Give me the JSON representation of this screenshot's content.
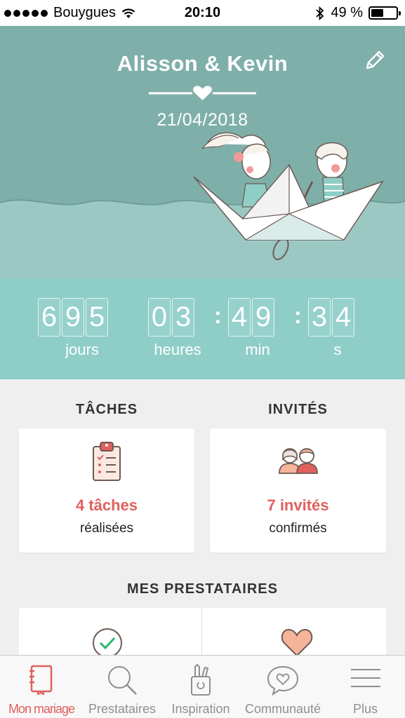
{
  "status_bar": {
    "carrier": "Bouygues",
    "time": "20:10",
    "battery_percent": "49 %",
    "battery_level": 0.49
  },
  "hero": {
    "couple_name": "Alisson & Kevin",
    "wedding_date": "21/04/2018",
    "edit_icon": "pencil-icon"
  },
  "countdown": {
    "days": [
      "6",
      "9",
      "5"
    ],
    "hours": [
      "0",
      "3"
    ],
    "minutes": [
      "4",
      "9"
    ],
    "seconds": [
      "3",
      "4"
    ],
    "separator": ":",
    "labels": {
      "days": "jours",
      "hours": "heures",
      "minutes": "min",
      "seconds": "s"
    }
  },
  "tasks": {
    "title": "TÂCHES",
    "count": "4 tâches",
    "sub": "réalisées",
    "icon": "clipboard-icon"
  },
  "guests": {
    "title": "INVITÉS",
    "count": "7 invités",
    "sub": "confirmés",
    "icon": "guests-icon"
  },
  "vendors": {
    "title": "MES PRESTATAIRES",
    "items": [
      {
        "icon": "check-circle-icon"
      },
      {
        "icon": "heart-icon"
      }
    ]
  },
  "tab_bar": {
    "items": [
      {
        "label": "Mon mariage",
        "icon": "notebook-icon",
        "active": true
      },
      {
        "label": "Prestataires",
        "icon": "search-icon",
        "active": false
      },
      {
        "label": "Inspiration",
        "icon": "pencil-cup-icon",
        "active": false
      },
      {
        "label": "Communauté",
        "icon": "chat-heart-icon",
        "active": false
      },
      {
        "label": "Plus",
        "icon": "menu-icon",
        "active": false
      }
    ]
  },
  "colors": {
    "accent": "#e0605d",
    "hero_sky": "#7fafa9",
    "countdown_bg": "#8ecec7",
    "tab_inactive": "#8e8e8e"
  }
}
